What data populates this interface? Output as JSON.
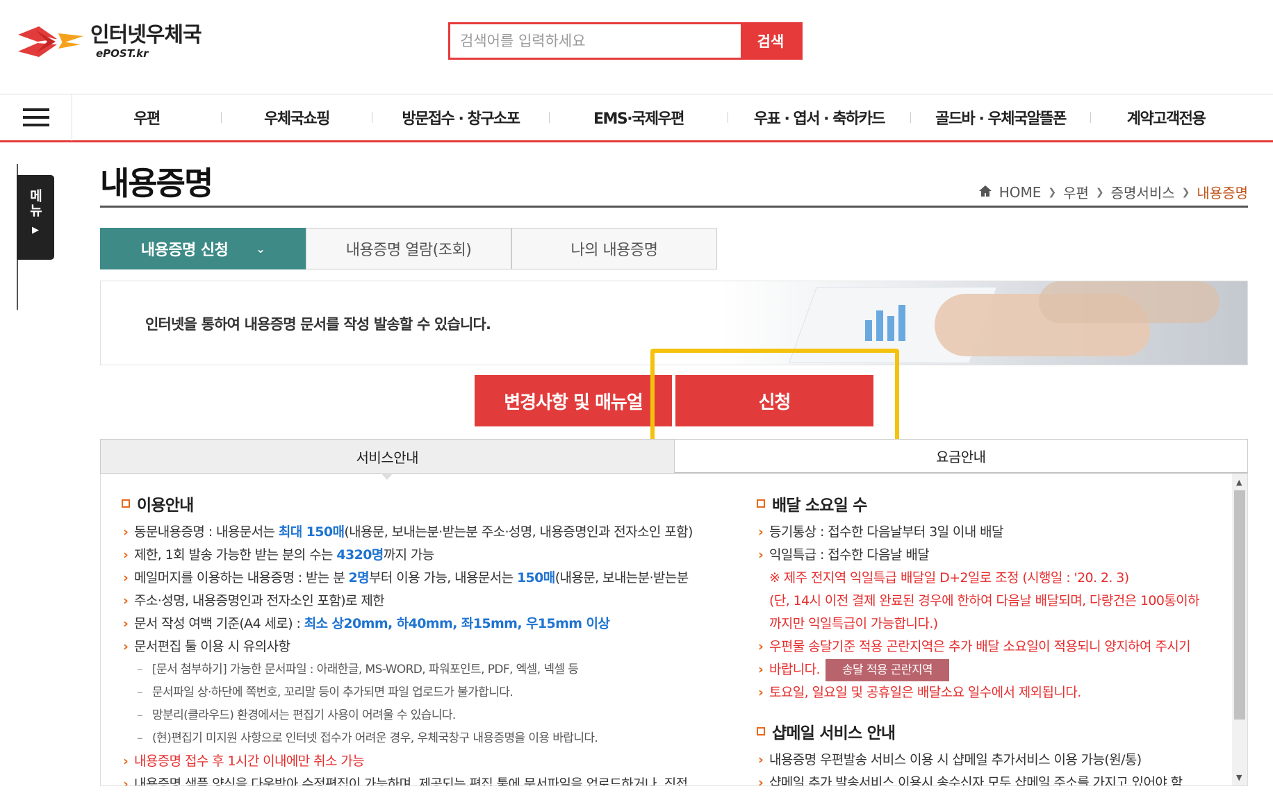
{
  "header": {
    "logo_title": "인터넷우체국",
    "logo_sub": "ePOST.kr",
    "search_placeholder": "검색어를 입력하세요",
    "search_button": "검색"
  },
  "nav": {
    "items": [
      "우편",
      "우체국쇼핑",
      "방문접수 · 창구소포",
      "EMS·국제우편",
      "우표 · 엽서 · 축하카드",
      "골드바 · 우체국알뜰폰",
      "계약고객전용"
    ]
  },
  "side_tab": {
    "label": "메뉴"
  },
  "page": {
    "title": "내용증명",
    "breadcrumb": [
      "HOME",
      "우편",
      "증명서비스",
      "내용증명"
    ]
  },
  "tabs": [
    "내용증명 신청",
    "내용증명 열람(조회)",
    "나의 내용증명"
  ],
  "banner": {
    "text": "인터넷을 통하여 내용증명 문서를 작성 발송할 수 있습니다."
  },
  "buttons": {
    "manual": "변경사항 및 매뉴얼",
    "apply": "신청"
  },
  "subtabs": [
    "서비스안내",
    "요금안내"
  ],
  "left": {
    "title": "이용안내",
    "i1_a": "동문내용증명 : 내용문서는 ",
    "i1_b": "최대 150매",
    "i1_c": "(내용문, 보내는분·받는분 주소·성명, 내용증명인과 전자소인 포함)",
    "i1_d": "제한, 1회 발송 가능한 받는 분의 수는 ",
    "i1_e": "4320명",
    "i1_f": "까지 가능",
    "i2_a": "메일머지를 이용하는 내용증명 : 받는 분 ",
    "i2_b": "2명",
    "i2_c": "부터 이용 가능, 내용문서는 ",
    "i2_d": "150매",
    "i2_e": "(내용문, 보내는분·받는분",
    "i2_f": "주소·성명, 내용증명인과 전자소인 포함)로 제한",
    "i3_a": "문서 작성 여백 기준(A4 세로) : ",
    "i3_b": "최소 상20mm, 하40mm, 좌15mm, 우15mm 이상",
    "i4": "문서편집 툴 이용 시 유의사항",
    "s1": "[문서 첨부하기] 가능한 문서파일 : 아래한글, MS-WORD, 파워포인트, PDF, 엑셀, 넥셀 등",
    "s2": "문서파일 상·하단에 쪽번호, 꼬리말 등이 추가되면 파일 업로드가 불가합니다.",
    "s3": "망분리(클라우드) 환경에서는 편집기 사용이 어려울 수 있습니다.",
    "s4": "(현)편집기 미지원 사항으로 인터넷 접수가 어려운 경우, 우체국창구 내용증명을 이용 바랍니다.",
    "i5": "내용증명 접수 후 1시간 이내에만 취소 가능",
    "i6": "내용증명 샘플 양식을 다운받아 수정편집이 가능하며, 제공되는 편집 툴에 문서파일을 업로드하거나, 직접"
  },
  "right": {
    "title1": "배달 소요일 수",
    "r1": "등기통상 : 접수한 다음날부터 3일 이내 배달",
    "r2": "익일특급 : 접수한 다음날 배달",
    "n1": "※ 제주 전지역 익일특급 배달일 D+2일로 조정 (시행일 : '20. 2. 3)",
    "n2": "(단, 14시 이전 결제 완료된 경우에 한하여 다음날 배달되며, 다량건은 100통이하",
    "n3": "까지만 익일특급이 가능합니다.)",
    "r3a": "우편물 송달기준 적용 곤란지역은 추가 배달 소요일이 적용되니 양지하여 주시기",
    "r3b": "바랍니다.",
    "area_button": "송달 적용 곤란지역",
    "r4": "토요일, 일요일 및 공휴일은 배달소요 일수에서 제외됩니다.",
    "title2": "샵메일 서비스 안내",
    "r5": "내용증명 우편발송 서비스 이용 시 샵메일 추가서비스 이용 가능(원/통)",
    "r6": "샵메일 추가 발송서비스 이용시 송수신자 모두 샵메일 주소를 가지고 있어야 함"
  },
  "colors": {
    "brand_red": "#e23b3b",
    "tab_teal": "#3d8a86",
    "highlight": "#f4c20d",
    "link_blue": "#1f74d1"
  }
}
